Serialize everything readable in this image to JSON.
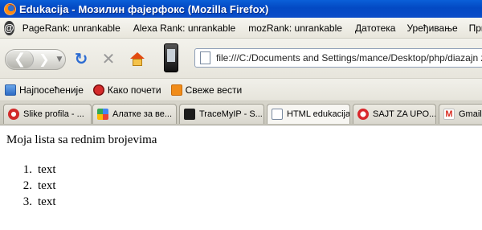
{
  "window": {
    "title": "Edukacija - Мозилин фајерфокс (Mozilla Firefox)"
  },
  "seo_toolbar": {
    "items": [
      "PageRank: unrankable",
      "Alexa Rank: unrankable",
      "mozRank: unrankable",
      "Датотека",
      "Уређивање",
      "Приказ"
    ]
  },
  "navbar": {
    "url": "file:///C:/Documents and Settings/mance/Desktop/php/diazajn za no"
  },
  "bookmarks": [
    {
      "label": "Најпосећеније",
      "icon": "most-visited-icon"
    },
    {
      "label": "Како почети",
      "icon": "getting-started-icon"
    },
    {
      "label": "Свеже вести",
      "icon": "rss-feed-icon"
    }
  ],
  "tabs": [
    {
      "label": "Slike profila - ...",
      "icon": "slike-icon"
    },
    {
      "label": "Алатке за ве...",
      "icon": "google-icon"
    },
    {
      "label": "TraceMyIP - S...",
      "icon": "tracemyip-icon"
    },
    {
      "label": "HTML edukacija",
      "icon": "page-icon"
    },
    {
      "label": "SAJT ZA UPO...",
      "icon": "heart-icon"
    },
    {
      "label": "Gmail",
      "icon": "gmail-icon"
    }
  ],
  "content": {
    "heading": "Moja lista sa rednim brojevima",
    "list": [
      {
        "num": "1.",
        "text": "text"
      },
      {
        "num": "2.",
        "text": "text"
      },
      {
        "num": "3.",
        "text": "text"
      }
    ]
  }
}
